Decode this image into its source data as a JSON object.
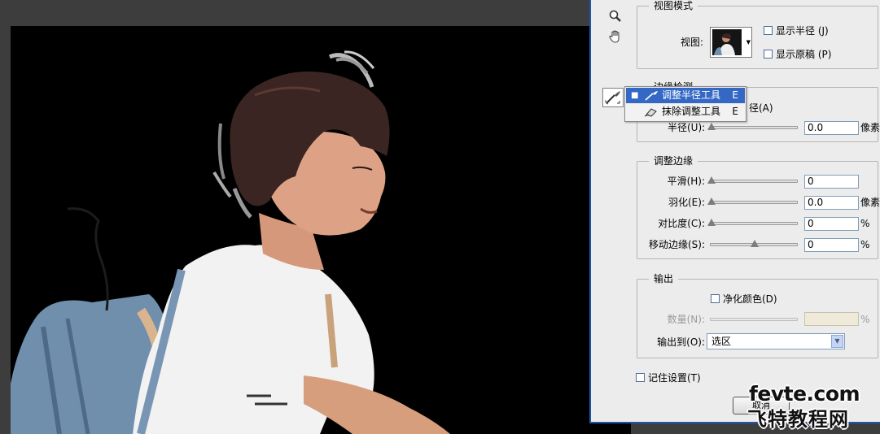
{
  "view_mode": {
    "title": "视图模式",
    "view_label": "视图:",
    "show_radius": "显示半径 (J)",
    "show_original": "显示原稿 (P)"
  },
  "tool_menu": {
    "items": [
      {
        "label": "调整半径工具",
        "shortcut": "E",
        "selected": true
      },
      {
        "label": "抹除调整工具",
        "shortcut": "E",
        "selected": false
      }
    ]
  },
  "edge_detection": {
    "title": "边缘检测",
    "smart_radius_partial": "径(A)",
    "radius_label": "半径(U):",
    "radius_value": "0.0",
    "radius_unit": "像素"
  },
  "adjust_edge": {
    "title": "调整边缘",
    "smooth_label": "平滑(H):",
    "smooth_value": "0",
    "feather_label": "羽化(E):",
    "feather_value": "0.0",
    "feather_unit": "像素",
    "contrast_label": "对比度(C):",
    "contrast_value": "0",
    "contrast_unit": "%",
    "shift_label": "移动边缘(S):",
    "shift_value": "0",
    "shift_unit": "%",
    "shift_level": 0.5
  },
  "output": {
    "title": "输出",
    "decontaminate": "净化颜色(D)",
    "amount_label": "数量(N):",
    "amount_unit": "%",
    "output_to_label": "输出到(O):",
    "output_to_value": "选区"
  },
  "remember": "记住设置(T)",
  "cancel_partial": "取消",
  "watermark": {
    "url": "fevte.com",
    "cn": "飞特教程网"
  },
  "colors": {
    "menu_selected": "#3468c4",
    "dialog_border": "#1f57a7"
  }
}
